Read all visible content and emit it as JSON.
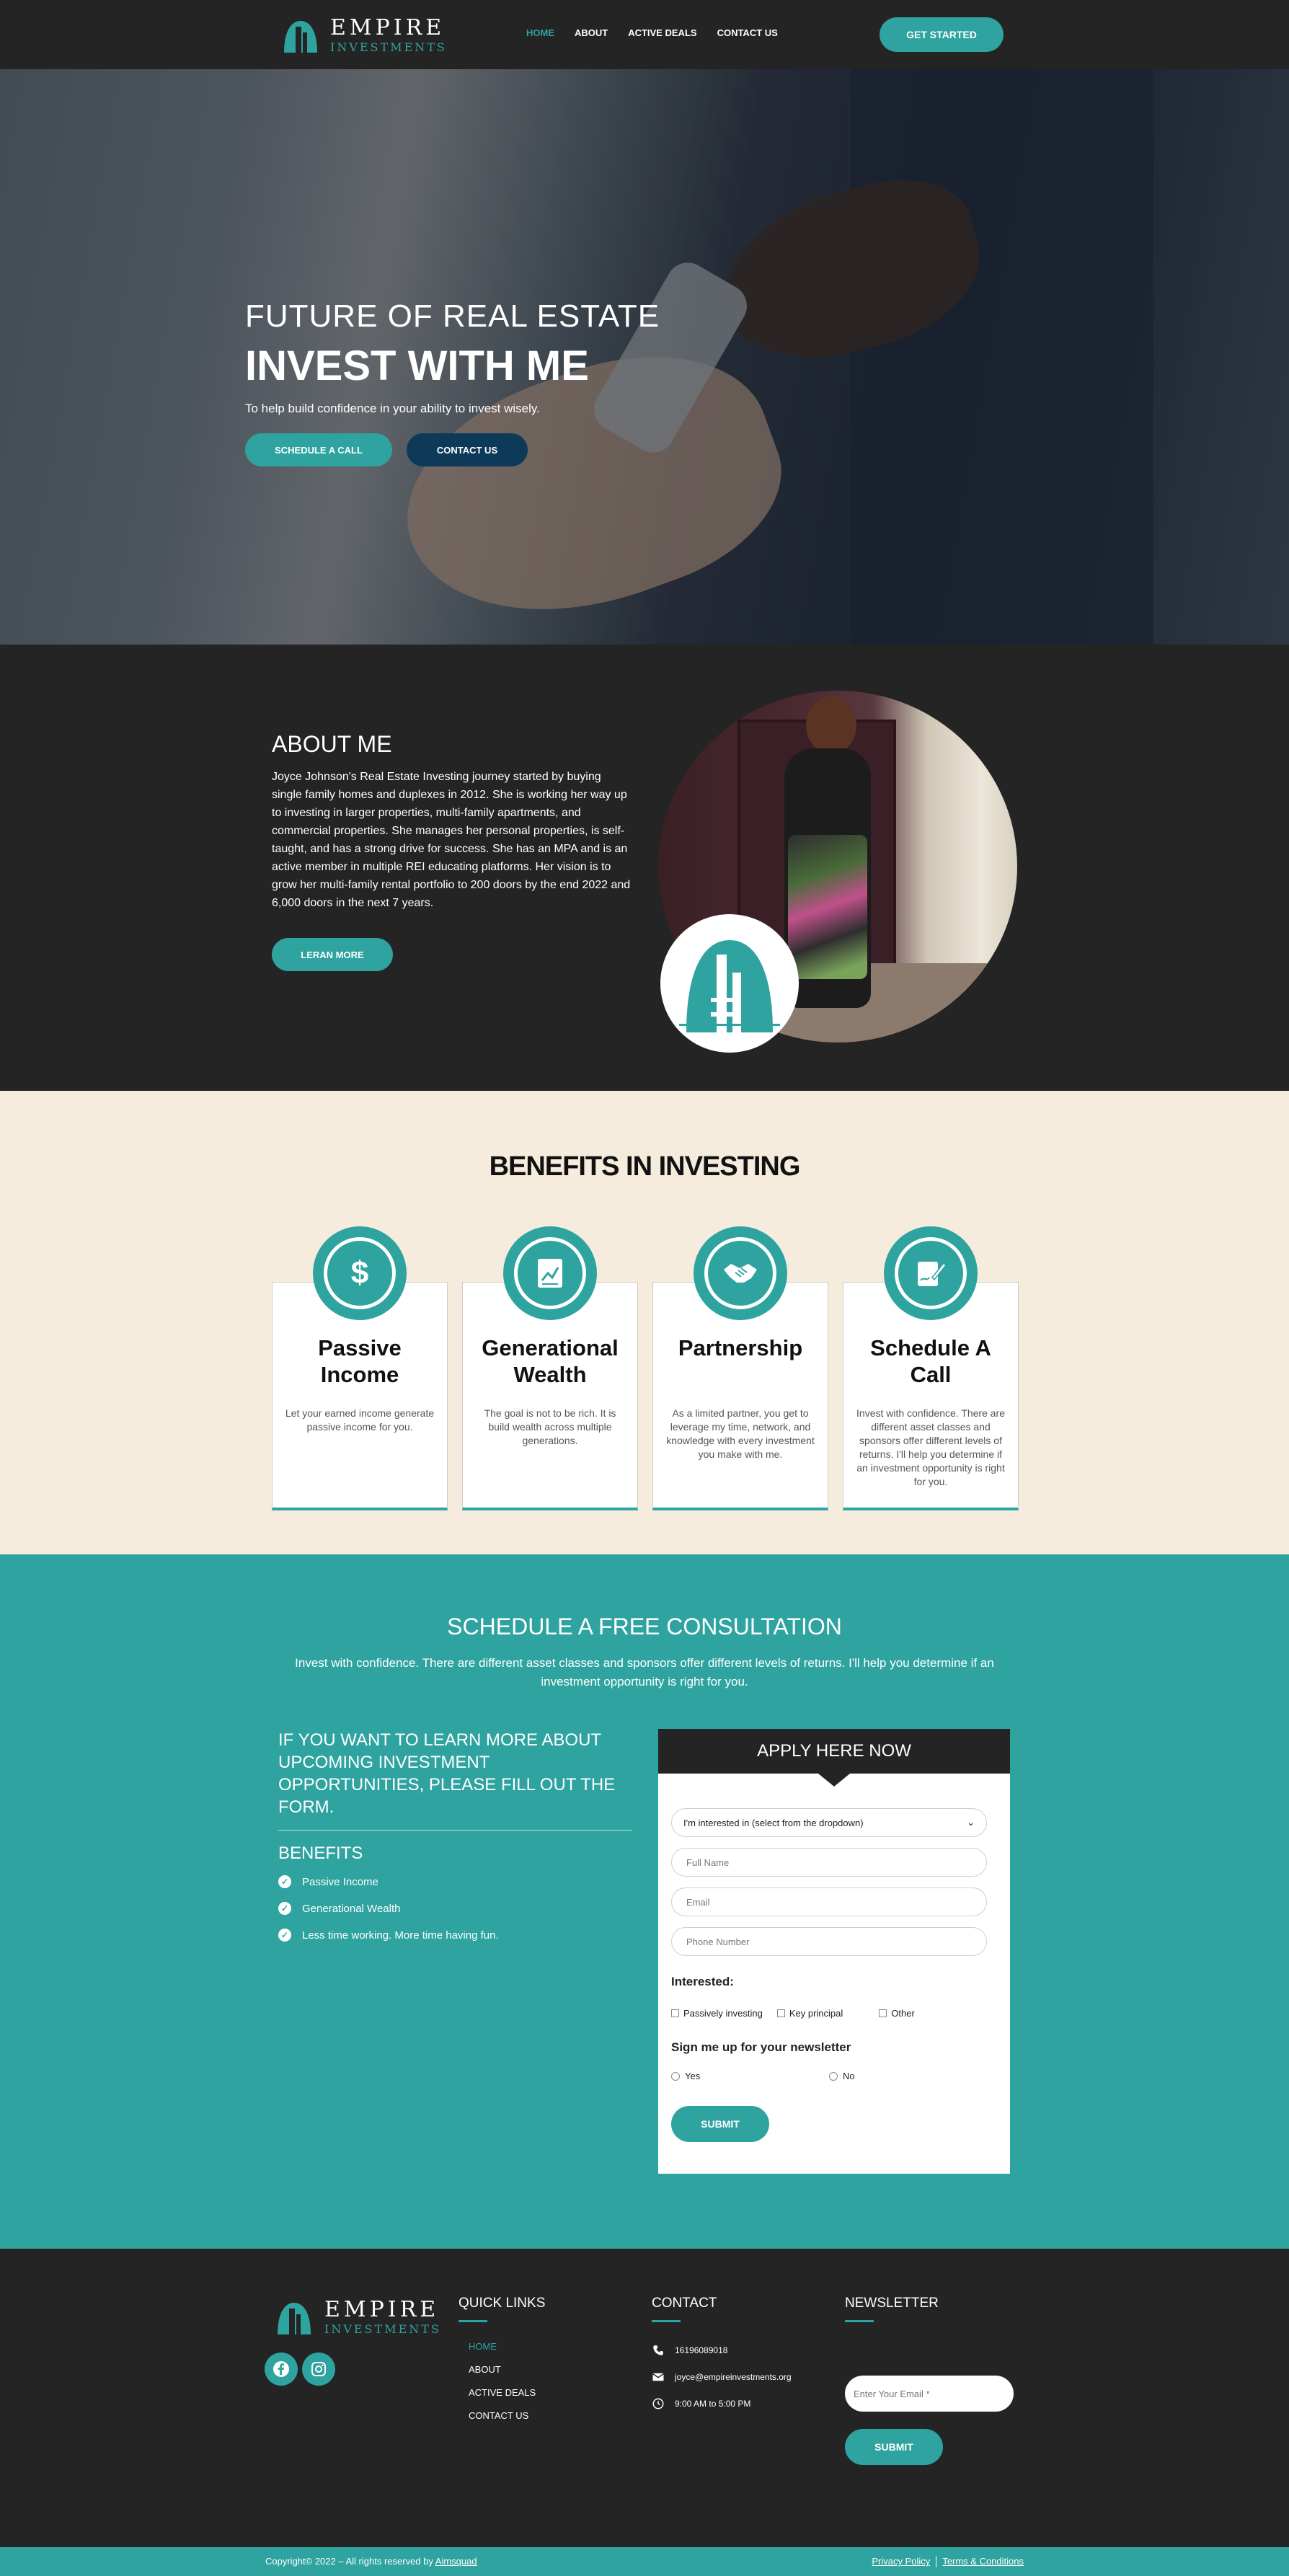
{
  "brand": {
    "name": "EMPIRE",
    "tagline": "INVESTMENTS"
  },
  "nav": {
    "items": [
      "HOME",
      "ABOUT",
      "ACTIVE DEALS",
      "CONTACT US"
    ],
    "cta": "GET STARTED"
  },
  "hero": {
    "kicker": "FUTURE OF REAL ESTATE",
    "title": "INVEST WITH ME",
    "subtitle": "To help build confidence in your ability to invest wisely.",
    "btn_schedule": "SCHEDULE A CALL",
    "btn_contact": "CONTACT US"
  },
  "about": {
    "title": "ABOUT ME",
    "text": "Joyce Johnson's Real Estate Investing journey started by buying single family homes and duplexes in 2012. She is working her way up to investing in larger properties, multi-family apartments, and commercial properties. She manages her personal properties, is self-taught, and has a strong drive for success. She has an MPA and is an active member in multiple REI educating platforms. Her vision is to grow her multi-family rental portfolio to 200 doors by the end 2022 and 6,000 doors in the next 7 years.",
    "button": "LERAN MORE"
  },
  "benefits": {
    "title": "BENEFITS IN INVESTING",
    "cards": [
      {
        "icon": "dollar-icon",
        "title": "Passive Income",
        "desc": "Let your earned income generate passive income for you."
      },
      {
        "icon": "document-chart-icon",
        "title": "Generational Wealth",
        "desc": "The goal is not to be rich. It is build wealth across multiple generations."
      },
      {
        "icon": "handshake-icon",
        "title": "Partnership",
        "desc": "As a limited partner, you get to leverage my time, network, and knowledge with every investment you make with me."
      },
      {
        "icon": "sign-document-icon",
        "title": "Schedule A Call",
        "desc": "Invest with confidence. There are different asset classes and sponsors offer different levels of returns. I'll help you determine if an investment opportunity is right for you."
      }
    ]
  },
  "consult": {
    "title": "SCHEDULE A FREE CONSULTATION",
    "subtitle": "Invest with confidence. There are different asset classes and sponsors offer different levels of returns. I'll help you determine if an investment opportunity is right for you.",
    "left_heading": "IF YOU WANT TO LEARN MORE ABOUT UPCOMING INVESTMENT OPPORTUNITIES, PLEASE FILL OUT THE FORM.",
    "benefits_heading": "BENEFITS",
    "benefits": [
      "Passive Income",
      "Generational Wealth",
      "Less time working. More time having fun."
    ]
  },
  "form": {
    "heading": "APPLY HERE NOW",
    "select_value": "I'm interested in (select from the dropdown)",
    "placeholders": {
      "name": "Full Name",
      "email": "Email",
      "phone": "Phone Number"
    },
    "interested_label": "Interested:",
    "interested_options": [
      "Passively investing",
      "Key principal",
      "Other"
    ],
    "newsletter_label": "Sign me up for your newsletter",
    "newsletter_options": [
      "Yes",
      "No"
    ],
    "submit": "SUBMIT"
  },
  "footer": {
    "quick_links_title": "QUICK LINKS",
    "quick_links": [
      "HOME",
      "ABOUT",
      "ACTIVE DEALS",
      "CONTACT US"
    ],
    "contact_title": "CONTACT",
    "phone": "16196089018",
    "email": "joyce@empireinvestments.org",
    "hours": "9:00 AM to 5:00 PM",
    "newsletter_title": "NEWSLETTER",
    "newsletter_placeholder": "Enter Your Email *",
    "newsletter_submit": "SUBMIT"
  },
  "copyright": {
    "text": "Copyright© 2022 – All rights reserved by",
    "link": "Aimsquad",
    "privacy": "Privacy Policy",
    "terms": "Terms & Conditions"
  },
  "colors": {
    "accent": "#2ea3a0",
    "dark": "#242424",
    "cream": "#f5ecdd",
    "navy": "#0d3a59"
  }
}
